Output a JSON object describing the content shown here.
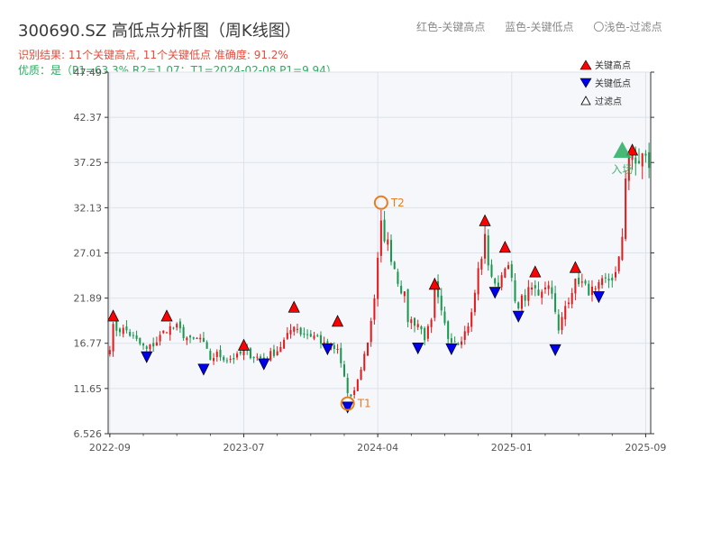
{
  "header": {
    "title": "300690.SZ 高低点分析图（周K线图）",
    "legend_red": "红色-关键高点",
    "legend_blue": "蓝色-关键低点",
    "legend_light": "〇浅色-过滤点",
    "status_line": "识别结果: 11个关键高点, 11个关键低点  准确度: 91.2%",
    "quality_line": "优质：是（P1=63.3%  R2=1.07；T1=2024-02-08 P1=9.94）"
  },
  "legend": {
    "high_label": "关键高点",
    "low_label": "关键低点",
    "filtered_label": "过滤点"
  },
  "colors": {
    "up": "#e41a1c",
    "down": "#1a9850",
    "high_marker": "#ff0000",
    "low_marker": "#0000ee",
    "t_marker": "#e67e22",
    "entry": "#27ae60",
    "plot_bg": "#f5f7fa",
    "grid": "#dde3ea"
  },
  "chart_data": {
    "type": "candlestick",
    "y_ticks": [
      "6.526",
      "11.65",
      "16.77",
      "21.89",
      "27.01",
      "32.13",
      "37.25",
      "42.37",
      "47.49"
    ],
    "ylim": [
      6.526,
      47.49
    ],
    "x_ticks": [
      "2022-09",
      "2023-07",
      "2024-04",
      "2025-01",
      "2025-09"
    ],
    "x_tick_positions": [
      0,
      40,
      80,
      120,
      160
    ],
    "n_candles": 162,
    "price_path": [
      [
        0,
        16.5
      ],
      [
        1,
        18.5
      ],
      [
        5,
        18.2
      ],
      [
        8,
        17.0
      ],
      [
        11,
        16.0
      ],
      [
        14,
        17.0
      ],
      [
        17,
        18.5
      ],
      [
        20,
        18.5
      ],
      [
        24,
        17.0
      ],
      [
        27,
        17.3
      ],
      [
        30,
        15.0
      ],
      [
        32,
        15.5
      ],
      [
        35,
        15.0
      ],
      [
        38,
        15.2
      ],
      [
        40,
        15.9
      ],
      [
        43,
        15.3
      ],
      [
        46,
        15.0
      ],
      [
        50,
        16.0
      ],
      [
        53,
        17.5
      ],
      [
        55,
        19.0
      ],
      [
        57,
        18.0
      ],
      [
        62,
        17.5
      ],
      [
        65,
        16.0
      ],
      [
        68,
        16.0
      ],
      [
        70,
        13.0
      ],
      [
        71,
        11.0
      ],
      [
        72,
        10.5
      ],
      [
        74,
        12.5
      ],
      [
        77,
        17.0
      ],
      [
        79,
        22.0
      ],
      [
        80,
        26.0
      ],
      [
        81,
        30.0
      ],
      [
        83,
        28.0
      ],
      [
        86,
        24.0
      ],
      [
        88,
        22.0
      ],
      [
        89,
        19.5
      ],
      [
        92,
        19.0
      ],
      [
        94,
        17.5
      ],
      [
        96,
        19.0
      ],
      [
        97,
        23.0
      ],
      [
        99,
        20.0
      ],
      [
        101,
        17.5
      ],
      [
        104,
        17.0
      ],
      [
        106,
        18.0
      ],
      [
        108,
        20.0
      ],
      [
        110,
        25.0
      ],
      [
        112,
        28.5
      ],
      [
        113,
        26.0
      ],
      [
        115,
        23.0
      ],
      [
        117,
        24.5
      ],
      [
        118,
        26.0
      ],
      [
        120,
        24.0
      ],
      [
        121,
        21.0
      ],
      [
        124,
        22.0
      ],
      [
        126,
        23.0
      ],
      [
        128,
        22.5
      ],
      [
        130,
        23.5
      ],
      [
        132,
        23.0
      ],
      [
        133,
        20.0
      ],
      [
        134,
        18.0
      ],
      [
        136,
        21.0
      ],
      [
        138,
        23.0
      ],
      [
        140,
        24.0
      ],
      [
        142,
        23.0
      ],
      [
        145,
        22.5
      ],
      [
        147,
        23.5
      ],
      [
        149,
        24.0
      ],
      [
        151,
        24.5
      ],
      [
        152,
        26.0
      ],
      [
        153,
        29.0
      ],
      [
        154,
        36.0
      ],
      [
        155,
        38.0
      ],
      [
        157,
        37.0
      ],
      [
        159,
        38.0
      ],
      [
        161,
        37.0
      ]
    ],
    "key_highs": [
      {
        "i": 1,
        "price": 19.9
      },
      {
        "i": 17,
        "price": 19.9
      },
      {
        "i": 40,
        "price": 16.6
      },
      {
        "i": 55,
        "price": 20.9
      },
      {
        "i": 68,
        "price": 19.3
      },
      {
        "i": 97,
        "price": 23.5
      },
      {
        "i": 112,
        "price": 30.7
      },
      {
        "i": 118,
        "price": 27.7
      },
      {
        "i": 127,
        "price": 24.9
      },
      {
        "i": 139,
        "price": 25.4
      },
      {
        "i": 156,
        "price": 38.7
      }
    ],
    "key_lows": [
      {
        "i": 11,
        "price": 15.2
      },
      {
        "i": 28,
        "price": 13.8
      },
      {
        "i": 46,
        "price": 14.4
      },
      {
        "i": 65,
        "price": 16.1
      },
      {
        "i": 71,
        "price": 9.5
      },
      {
        "i": 92,
        "price": 16.2
      },
      {
        "i": 102,
        "price": 16.1
      },
      {
        "i": 115,
        "price": 22.5
      },
      {
        "i": 122,
        "price": 19.8
      },
      {
        "i": 133,
        "price": 16.0
      },
      {
        "i": 146,
        "price": 22.0
      }
    ],
    "t_points": [
      {
        "label": "T1",
        "i": 71,
        "price": 9.94
      },
      {
        "label": "T2",
        "i": 81,
        "price": 32.7
      }
    ],
    "entry": {
      "label": "入场",
      "i": 153,
      "price": 38.5
    }
  }
}
